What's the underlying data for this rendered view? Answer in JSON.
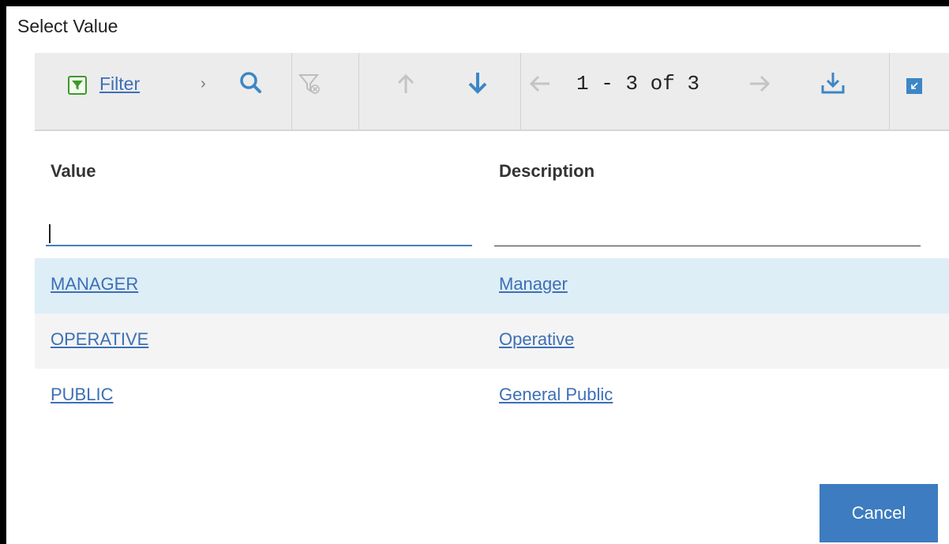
{
  "dialog": {
    "title": "Select Value"
  },
  "toolbar": {
    "filter_label": "Filter",
    "chevron": "›",
    "page_info": "1 - 3 of 3",
    "icons": [
      "filter-icon",
      "search-icon",
      "clear-filter-icon",
      "sort-up-icon",
      "sort-down-icon",
      "previous-page-icon",
      "next-page-icon",
      "download-icon",
      "collapse-icon"
    ],
    "accent_color": "#3d86c6",
    "filter_icon_color": "#3c9a2a"
  },
  "table": {
    "columns": [
      "Value",
      "Description"
    ],
    "filters": {
      "value": "",
      "description": ""
    },
    "rows": [
      {
        "value": "MANAGER",
        "description": "Manager",
        "selected": true
      },
      {
        "value": "OPERATIVE",
        "description": "Operative",
        "selected": false
      },
      {
        "value": "PUBLIC",
        "description": "General Public",
        "selected": false
      }
    ]
  },
  "footer": {
    "cancel_label": "Cancel"
  }
}
